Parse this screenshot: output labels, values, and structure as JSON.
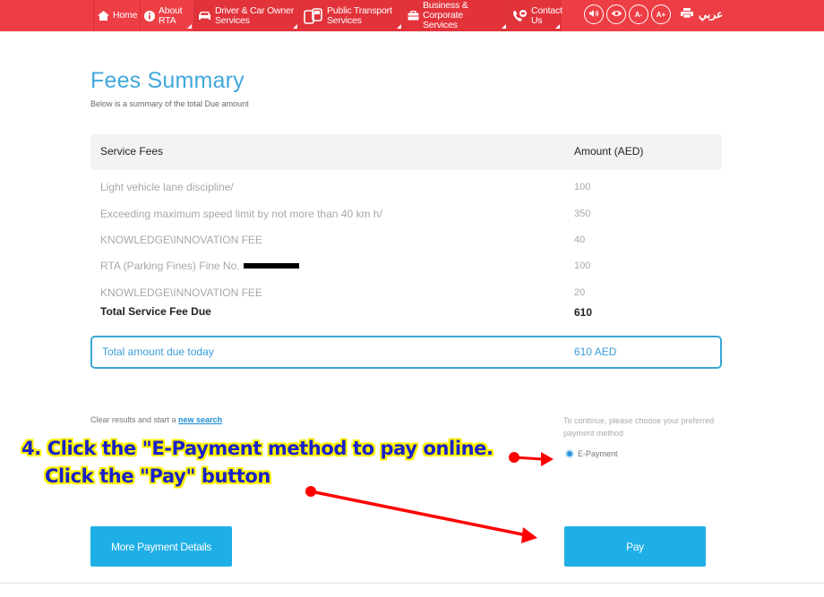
{
  "nav": {
    "items": [
      {
        "label": "Home",
        "icon": "home-icon"
      },
      {
        "label": "About RTA",
        "icon": "info-icon"
      },
      {
        "label": "Driver & Car Owner Services",
        "line1": "Driver & Car Owner",
        "line2": "Services",
        "icon": "car-icon"
      },
      {
        "label": "Public Transport Services",
        "line1": "Public Transport",
        "line2": "Services",
        "icon": "bus-icon"
      },
      {
        "label": "Business & Corporate Services",
        "line1": "Business & Corporate",
        "line2": "Services",
        "icon": "briefcase-icon"
      },
      {
        "label": "Contact Us",
        "line1": "Contact",
        "line2": "Us",
        "icon": "phone-icon"
      }
    ],
    "tools": {
      "decrease_font": "A-",
      "increase_font": "A+",
      "language": "عربي"
    },
    "colors": {
      "bar": "#ee3e45"
    }
  },
  "page": {
    "title": "Fees Summary",
    "subtitle": "Below is a summary of the total Due amount"
  },
  "table": {
    "headers": [
      "Service Fees",
      "Amount (AED)"
    ],
    "rows": [
      {
        "description": "Light vehicle lane discipline/",
        "amount": "100"
      },
      {
        "description": "Exceeding maximum speed limit by not more than 40 km h/",
        "amount": "350"
      },
      {
        "description": "KNOWLEDGE\\INNOVATION FEE",
        "amount": "40"
      },
      {
        "description": "RTA (Parking Fines) Fine No.",
        "amount": "100",
        "redacted": true
      },
      {
        "description": "KNOWLEDGE\\INNOVATION FEE",
        "amount": "20"
      }
    ],
    "total": {
      "label": "Total Service Fee Due",
      "amount": "610"
    }
  },
  "due_today": {
    "label": "Total amount due today",
    "amount": "610 AED"
  },
  "clear": {
    "prefix": "Clear results and start a ",
    "link": "new search"
  },
  "payment": {
    "prompt": "To continue, please choose your preferred payment method",
    "method_label": "E-Payment",
    "selected": true
  },
  "buttons": {
    "more": "More Payment Details",
    "pay": "Pay"
  },
  "annotation": {
    "line1": "4. Click the \"E-Payment method to pay online.",
    "line2": "Click the \"Pay\" button",
    "arrow_color": "#ff0000",
    "text_color": "#1a22c8",
    "outline_color": "#fff200"
  }
}
